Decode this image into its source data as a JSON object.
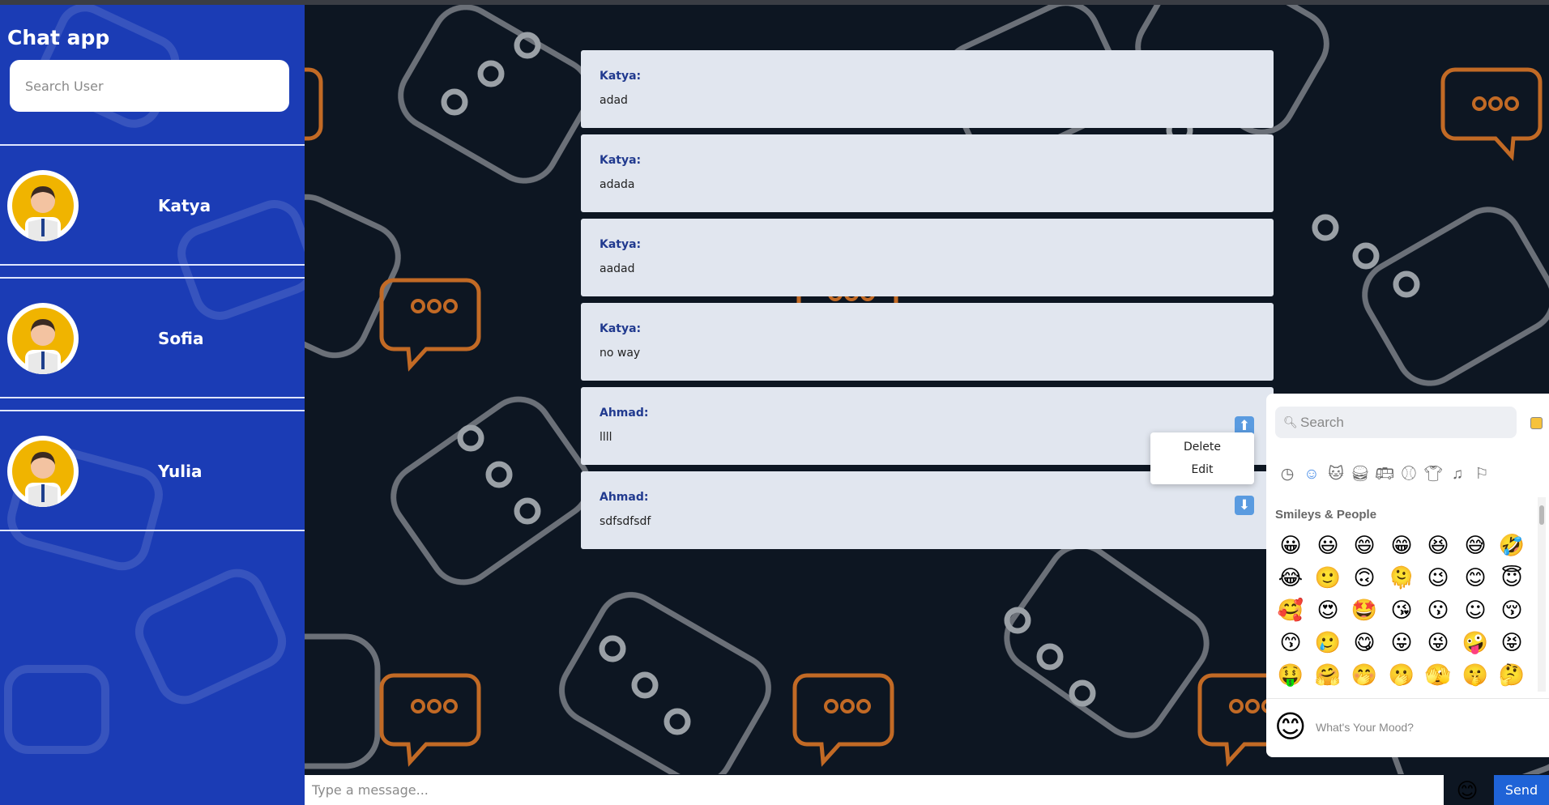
{
  "sidebar": {
    "title": "Chat app",
    "search_placeholder": "Search User",
    "users": [
      {
        "name": "Katya"
      },
      {
        "name": "Sofia"
      },
      {
        "name": "Yulia"
      }
    ]
  },
  "messages": [
    {
      "sender": "Katya:",
      "text": "adad"
    },
    {
      "sender": "Katya:",
      "text": "adada"
    },
    {
      "sender": "Katya:",
      "text": "aadad"
    },
    {
      "sender": "Katya:",
      "text": "no way"
    },
    {
      "sender": "Ahmad:",
      "text": "llll",
      "arrow": "⬆"
    },
    {
      "sender": "Ahmad:",
      "text": "sdfsdfsdf",
      "arrow": "⬇"
    }
  ],
  "context_menu": {
    "delete": "Delete",
    "edit": "Edit"
  },
  "emoji_picker": {
    "search_placeholder": "Search",
    "section_title": "Smileys & People",
    "preview_placeholder": "What's Your Mood?",
    "preview_emoji": "😊",
    "categories": [
      "recent-icon",
      "smileys-icon",
      "animals-icon",
      "food-icon",
      "travel-icon",
      "activities-icon",
      "objects-icon",
      "symbols-icon",
      "flags-icon"
    ],
    "emojis": [
      "😀",
      "😃",
      "😄",
      "😁",
      "😆",
      "😅",
      "🤣",
      "😂",
      "🙂",
      "🙃",
      "🫠",
      "😉",
      "😊",
      "😇",
      "🥰",
      "😍",
      "🤩",
      "😘",
      "😗",
      "☺",
      "😚",
      "😙",
      "🥲",
      "😋",
      "😛",
      "😜",
      "🤪",
      "😝",
      "🤑",
      "🤗",
      "🤭",
      "🫢",
      "🫣",
      "🤫",
      "🤔"
    ]
  },
  "composer": {
    "placeholder": "Type a message...",
    "emoji_button": "😊",
    "send_label": "Send"
  },
  "colors": {
    "sidebar": "#1b3cb5",
    "chat_bg": "#0d1622",
    "send_button": "#1f63d7"
  }
}
